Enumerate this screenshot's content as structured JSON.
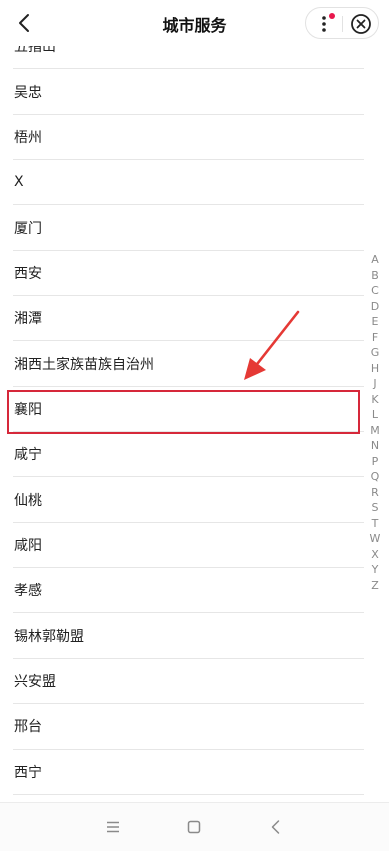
{
  "header": {
    "title": "城市服务"
  },
  "cities": [
    "五指山",
    "吴忠",
    "梧州",
    "X",
    "厦门",
    "西安",
    "湘潭",
    "湘西土家族苗族自治州",
    "襄阳",
    "咸宁",
    "仙桃",
    "咸阳",
    "孝感",
    "锡林郭勒盟",
    "兴安盟",
    "邢台",
    "西宁",
    ""
  ],
  "index_letters": [
    "A",
    "B",
    "C",
    "D",
    "E",
    "F",
    "G",
    "H",
    "J",
    "K",
    "L",
    "M",
    "N",
    "P",
    "Q",
    "R",
    "S",
    "T",
    "W",
    "X",
    "Y",
    "Z"
  ],
  "highlighted_city": "襄阳",
  "colors": {
    "accent": "#d6283a",
    "badge": "#e8174c"
  },
  "icons": {
    "back": "chevron-left-icon",
    "more": "more-vertical-icon",
    "close": "close-circle-icon",
    "nav_menu": "menu-icon",
    "nav_home": "square-icon",
    "nav_back": "chevron-left-icon"
  }
}
